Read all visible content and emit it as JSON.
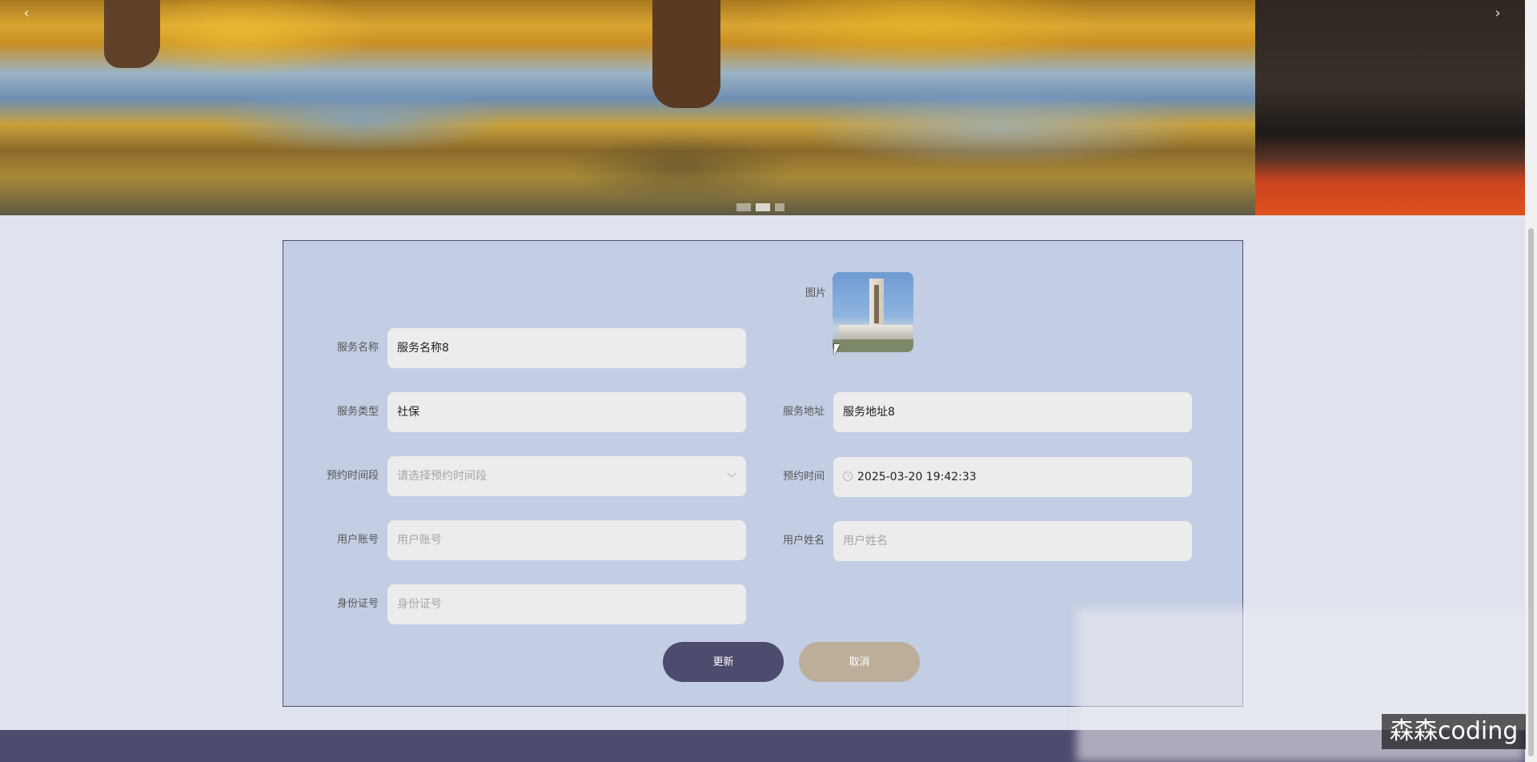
{
  "carousel": {
    "prev_icon": "‹",
    "next_icon": "›",
    "indicator_count": 3,
    "active_index": 1
  },
  "form": {
    "image_label": "图片",
    "service_name": {
      "label": "服务名称",
      "value": "服务名称8"
    },
    "service_type": {
      "label": "服务类型",
      "value": "社保"
    },
    "service_address": {
      "label": "服务地址",
      "value": "服务地址8"
    },
    "time_slot": {
      "label": "预约时间段",
      "placeholder": "请选择预约时间段"
    },
    "appointment_time": {
      "label": "预约时间",
      "value": "2025-03-20 19:42:33"
    },
    "user_account": {
      "label": "用户账号",
      "placeholder": "用户账号"
    },
    "user_name": {
      "label": "用户姓名",
      "placeholder": "用户姓名"
    },
    "id_number": {
      "label": "身份证号",
      "placeholder": "身份证号"
    }
  },
  "buttons": {
    "update": "更新",
    "cancel": "取消"
  },
  "watermark": "森森coding",
  "colors": {
    "panel_bg": "#c3cde3",
    "primary": "#4e4c6e",
    "cancel": "#bcae99"
  }
}
